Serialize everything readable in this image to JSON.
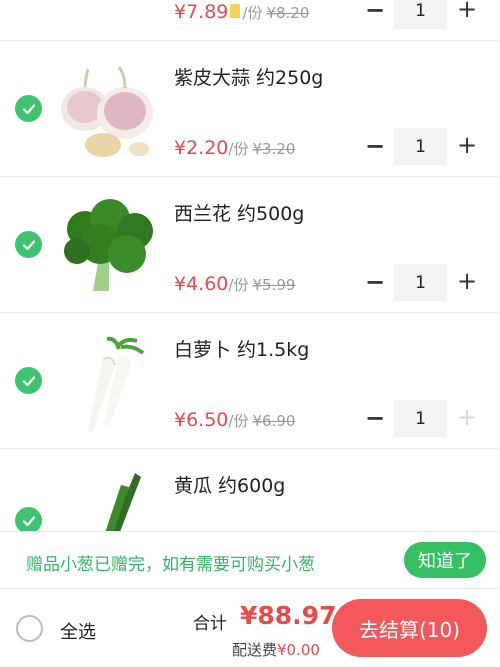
{
  "items": [
    {
      "name": "",
      "price": "¥7.89",
      "unit": "/份",
      "orig": "¥8.20",
      "qty": "1",
      "checked": true,
      "image": "produce-image"
    },
    {
      "name": "紫皮大蒜 约250g",
      "price": "¥2.20",
      "unit": "/份",
      "orig": "¥3.20",
      "qty": "1",
      "checked": true,
      "image": "garlic-image"
    },
    {
      "name": "西兰花 约500g",
      "price": "¥4.60",
      "unit": "/份",
      "orig": "¥5.99",
      "qty": "1",
      "checked": true,
      "image": "broccoli-image"
    },
    {
      "name": "白萝卜 约1.5kg",
      "price": "¥6.50",
      "unit": "/份",
      "orig": "¥6.90",
      "qty": "1",
      "checked": true,
      "image": "radish-image",
      "plus_disabled": true
    },
    {
      "name": "黄瓜 约600g",
      "price": "",
      "unit": "",
      "orig": "",
      "qty": "",
      "checked": true,
      "image": "cucumber-image"
    }
  ],
  "controls": {
    "minus": "−",
    "plus": "+"
  },
  "gift_bar": {
    "text": "赠品小葱已赠完，如有需要可购买小葱",
    "button": "知道了"
  },
  "bottom_bar": {
    "select_all": "全选",
    "total_label": "合计",
    "total_value": "¥88.97",
    "shipping_label": "配送费",
    "shipping_value": "¥0.00",
    "checkout": "去结算(10)"
  },
  "colors": {
    "accent_green": "#3cc46f",
    "price_red": "#e84a4a",
    "checkout_red": "#f2585a"
  }
}
